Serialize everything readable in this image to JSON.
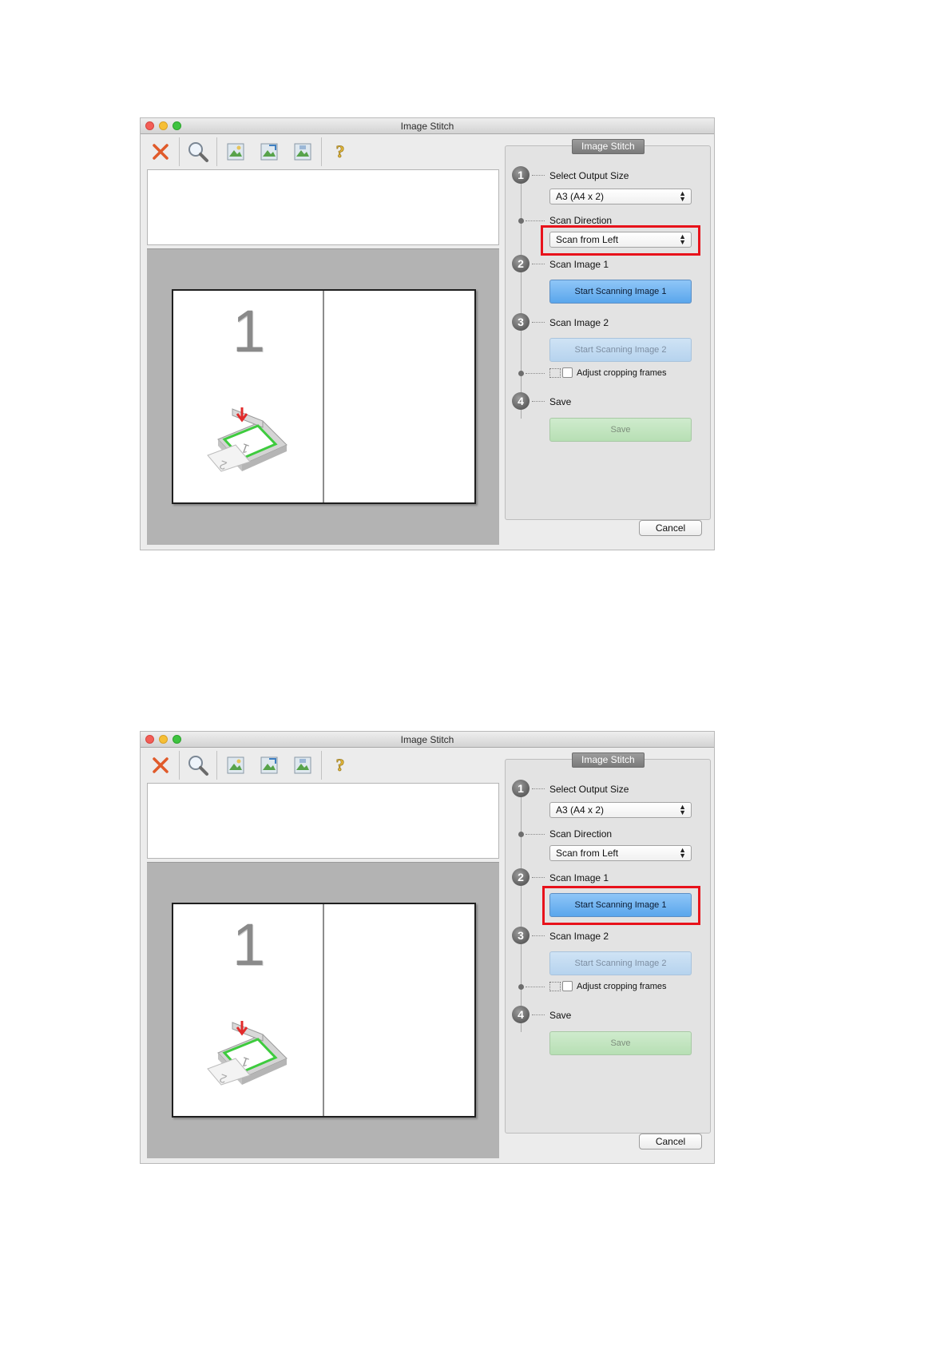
{
  "screens": [
    {
      "window_title": "Image Stitch",
      "panel_title": "Image Stitch",
      "page_number": "1",
      "steps": {
        "step1_num": "1",
        "step1_label": "Select Output Size",
        "output_size": "A3 (A4 x 2)",
        "scan_direction_label": "Scan Direction",
        "scan_direction": "Scan from Left",
        "step2_num": "2",
        "step2_label": "Scan Image 1",
        "start_scan1": "Start Scanning Image 1",
        "step3_num": "3",
        "step3_label": "Scan Image 2",
        "start_scan2": "Start Scanning Image 2",
        "adjust_label": "Adjust cropping frames",
        "step4_num": "4",
        "step4_label": "Save",
        "save": "Save"
      },
      "cancel": "Cancel",
      "highlighted": "scan-direction-select"
    },
    {
      "window_title": "Image Stitch",
      "panel_title": "Image Stitch",
      "page_number": "1",
      "steps": {
        "step1_num": "1",
        "step1_label": "Select Output Size",
        "output_size": "A3 (A4 x 2)",
        "scan_direction_label": "Scan Direction",
        "scan_direction": "Scan from Left",
        "step2_num": "2",
        "step2_label": "Scan Image 1",
        "start_scan1": "Start Scanning Image 1",
        "step3_num": "3",
        "step3_label": "Scan Image 2",
        "start_scan2": "Start Scanning Image 2",
        "adjust_label": "Adjust cropping frames",
        "step4_num": "4",
        "step4_label": "Save",
        "save": "Save"
      },
      "cancel": "Cancel",
      "highlighted": "start-scanning-image-1-button"
    }
  ],
  "toolbar_icons": [
    "close-icon",
    "zoom-icon",
    "image-icon",
    "image-next-icon",
    "image-save-icon",
    "help-icon"
  ],
  "colors": {
    "highlight": "#e8121b",
    "primary_button": "#5aa6ec"
  }
}
